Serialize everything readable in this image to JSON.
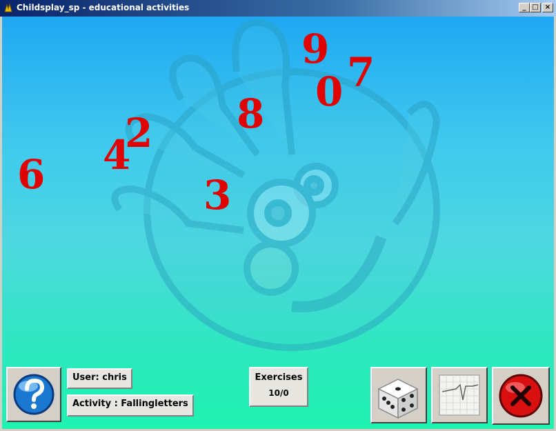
{
  "window": {
    "title": "Childsplay_sp - educational activities",
    "controls": [
      "minimize",
      "maximize",
      "close"
    ]
  },
  "game": {
    "falling_digits": [
      "9",
      "7",
      "0",
      "8",
      "2",
      "4",
      "6",
      "3"
    ]
  },
  "status": {
    "user_label": "User: chris",
    "activity_label": "Activity : Fallingletters",
    "exercises_title": "Exercises",
    "exercises_value": "10/0"
  },
  "buttons": {
    "help": "help-icon",
    "dice": "dice-icon",
    "graph": "graph-icon",
    "quit": "quit-icon"
  },
  "colors": {
    "digit": "#e00000",
    "background_top": "#1fa8f2",
    "background_bottom": "#1ff2b0"
  }
}
